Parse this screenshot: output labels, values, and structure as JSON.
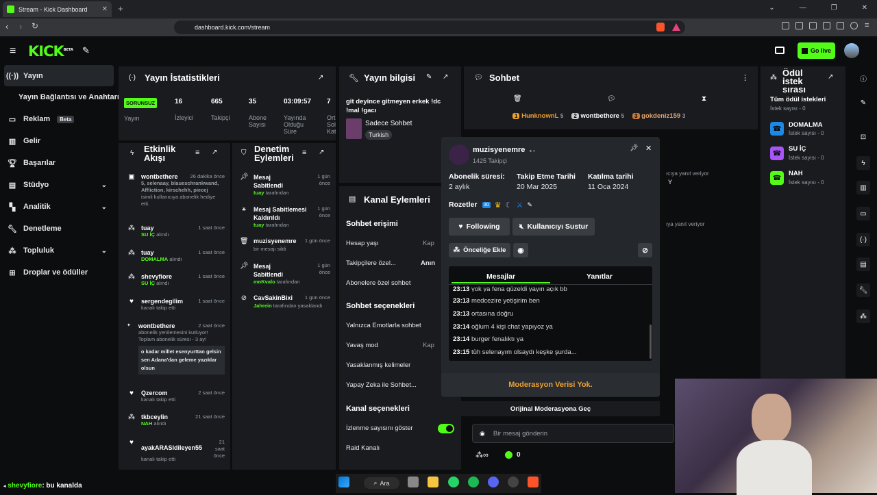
{
  "browser": {
    "tab_title": "Stream - Kick Dashboard",
    "url": "dashboard.kick.com/stream"
  },
  "header": {
    "logo": "KICK",
    "logo_badge": "BETA",
    "go_live": "Go live"
  },
  "sidebar": {
    "items": [
      {
        "label": "Yayın",
        "icon": "broadcast-icon"
      },
      {
        "label": "Yayın Bağlantısı ve Anahtarı"
      },
      {
        "label": "Reklam",
        "badge": "Beta",
        "icon": "monitor-icon"
      },
      {
        "label": "Gelir",
        "icon": "chart-icon"
      },
      {
        "label": "Başarılar",
        "icon": "trophy-icon"
      },
      {
        "label": "Stüdyo",
        "icon": "studio-icon"
      },
      {
        "label": "Analitik",
        "icon": "analytics-icon"
      },
      {
        "label": "Denetleme",
        "icon": "wrench-icon"
      },
      {
        "label": "Topluluk",
        "icon": "community-icon"
      },
      {
        "label": "Droplar ve ödüller",
        "icon": "drops-icon"
      }
    ]
  },
  "stats": {
    "title": "Yayın İstatistikleri",
    "problem_badge": "SORUNSUZ",
    "yayin": "Yayın",
    "items": [
      {
        "value": "16",
        "label": "İzleyici"
      },
      {
        "value": "665",
        "label": "Takipçi"
      },
      {
        "value": "35",
        "label": "Abone Sayısı"
      },
      {
        "value": "03:09:57",
        "label": "Yayında Olduğu Süre"
      },
      {
        "value": "7",
        "label": "Ort Sol Kat"
      }
    ]
  },
  "info": {
    "title": "Yayın bilgisi",
    "stream_title": "git deyince gitmeyen erkek !dc !mal !gacı",
    "category": "Sadece Sohbet",
    "tag": "Turkish"
  },
  "activity": {
    "title": "Etkinlik Akışı",
    "items": [
      {
        "name": "wontbethere",
        "time": "26 dakika önce",
        "green": "5, selenaay, blaueschrankwand, Affliction, kirschehh, piecej",
        "sub": "isimli kullanıcıya abonelik hediye etti."
      },
      {
        "name": "tuay",
        "time": "1 saat önce",
        "green": "SU İÇ",
        "sub": "alındı"
      },
      {
        "name": "tuay",
        "time": "1 saat önce",
        "green": "DOMALMA",
        "sub": "alındı"
      },
      {
        "name": "shevyfiore",
        "time": "1 saat önce",
        "green": "SU İÇ",
        "sub": "alındı"
      },
      {
        "name": "sergendegilim",
        "time": "1 saat önce",
        "sub": "kanalı takip etti"
      },
      {
        "name": "wontbethere",
        "time": "2 saat önce",
        "sub": "abonelik yenilemesini kutluyor! Toplam abonelik süresi - 3 ay!",
        "quote": "o kadar millet esenyurttan gelsin sen Adana'dan geleme yazıklar olsun"
      },
      {
        "name": "Qzercom",
        "time": "2 saat önce",
        "sub": "kanalı takip etti"
      },
      {
        "name": "tkbceylin",
        "time": "21 saat önce",
        "green": "NAH",
        "sub": "alındı"
      },
      {
        "name": "ayakARASIdileyen55",
        "time": "21 saat önce",
        "sub": "kanalı takip etti"
      }
    ]
  },
  "moderation": {
    "title": "Denetim Eylemleri",
    "items": [
      {
        "action": "Mesaj Sabitlendi",
        "time": "1 gün önce",
        "by": "tuay",
        "suffix": "tarafından"
      },
      {
        "action": "Mesaj Sabitlemesi Kaldırıldı",
        "time": "1 gün önce",
        "by": "tuay",
        "suffix": "tarafından"
      },
      {
        "action": "muzisyenemre",
        "time": "1 gün önce",
        "by": "",
        "suffix": "bir mesajı sildi"
      },
      {
        "action": "Mesaj Sabitlendi",
        "time": "1 gün önce",
        "by": "mnKvalo",
        "suffix": "tarafından"
      },
      {
        "action": "CavSakinBixi",
        "time": "1 gün önce",
        "by": "Jahrein",
        "suffix": "tarafından yasaklandı"
      }
    ]
  },
  "channel": {
    "title": "Kanal Eylemleri",
    "chat_access": "Sohbet erişimi",
    "rows1": [
      {
        "label": "Hesap yaşı",
        "value": "Kap"
      },
      {
        "label": "Takipçilere özel...",
        "value": "Anın"
      },
      {
        "label": "Abonelere özel sohbet",
        "value": ""
      }
    ],
    "chat_options": "Sohbet seçenekleri",
    "rows2": [
      {
        "label": "Yalnızca Emotlarla sohbet",
        "value": ""
      },
      {
        "label": "Yavaş mod",
        "value": "Kap"
      },
      {
        "label": "Yasaklanmış kelimeler",
        "value": ""
      },
      {
        "label": "Yapay Zeka ile Sohbet...",
        "value": ""
      }
    ],
    "channel_options": "Kanal seçenekleri",
    "rows3": [
      {
        "label": "İzlenme sayısını göster"
      },
      {
        "label": "Raid Kanalı"
      }
    ]
  },
  "chat": {
    "title": "Sohbet",
    "top": [
      {
        "rank": "1",
        "name": "HunknownL",
        "count": "5"
      },
      {
        "rank": "2",
        "name": "wontbethere",
        "count": "5"
      },
      {
        "rank": "3",
        "name": "gokdeniz159",
        "count": "3"
      }
    ],
    "reply_hint1": "ıcıya yanıt veriyor",
    "reply_hint2": "ıya yanıt veriyor",
    "partial": "Y",
    "placeholder": "Bir mesaj gönderin",
    "points": "0"
  },
  "popup": {
    "username": "muzisyenemre",
    "followers": "1425 Takipçi",
    "sub_label": "Abonelik süresi:",
    "sub_value": "2 aylık",
    "follow_label": "Takip Etme Tarihi",
    "follow_value": "20 Mar 2025",
    "join_label": "Katılma tarihi",
    "join_value": "11 Oca 2024",
    "badges_label": "Rozetler",
    "badge_num": "30",
    "following": "Following",
    "mute": "Kullanıcıyı Sustur",
    "priority": "Önceliğe Ekle",
    "tab_messages": "Mesajlar",
    "tab_replies": "Yanıtlar",
    "messages": [
      {
        "t": "23:13",
        "m": "yok ya fena güzeldi yayın açık bb"
      },
      {
        "t": "23:13",
        "m": "medcezire yetişirim ben"
      },
      {
        "t": "23:13",
        "m": "ortasına doğru"
      },
      {
        "t": "23:14",
        "m": "oğlum 4 kişi chat yapıyoz ya"
      },
      {
        "t": "23:14",
        "m": "burger fenalıktı ya"
      },
      {
        "t": "23:15",
        "m": "tüh selenayım olsaydı keşke şurda..."
      }
    ],
    "no_mod": "Moderasyon Verisi Yok.",
    "switch_mod": "Orijinal Moderasyona Geç"
  },
  "rewards": {
    "title": "Ödül istek sırası",
    "all": "Tüm ödül istekleri",
    "all_sub": "İstek sayısı - 0",
    "items": [
      {
        "name": "DOMALMA",
        "sub": "İstek sayısı - 0",
        "color": "#1e88e5"
      },
      {
        "name": "SU İÇ",
        "sub": "İstek sayısı - 0",
        "color": "#a855f7"
      },
      {
        "name": "NAH",
        "sub": "İstek sayısı - 0",
        "color": "#53fc18"
      }
    ]
  },
  "bottom_chat": {
    "user": "shevyfiore",
    "text": ": bu kanalda"
  },
  "taskbar": {
    "search": "Ara"
  },
  "colors": {
    "accent": "#53fc18",
    "panel": "#191b1f",
    "bg": "#0b0d0e",
    "orange": "#f0a030"
  }
}
